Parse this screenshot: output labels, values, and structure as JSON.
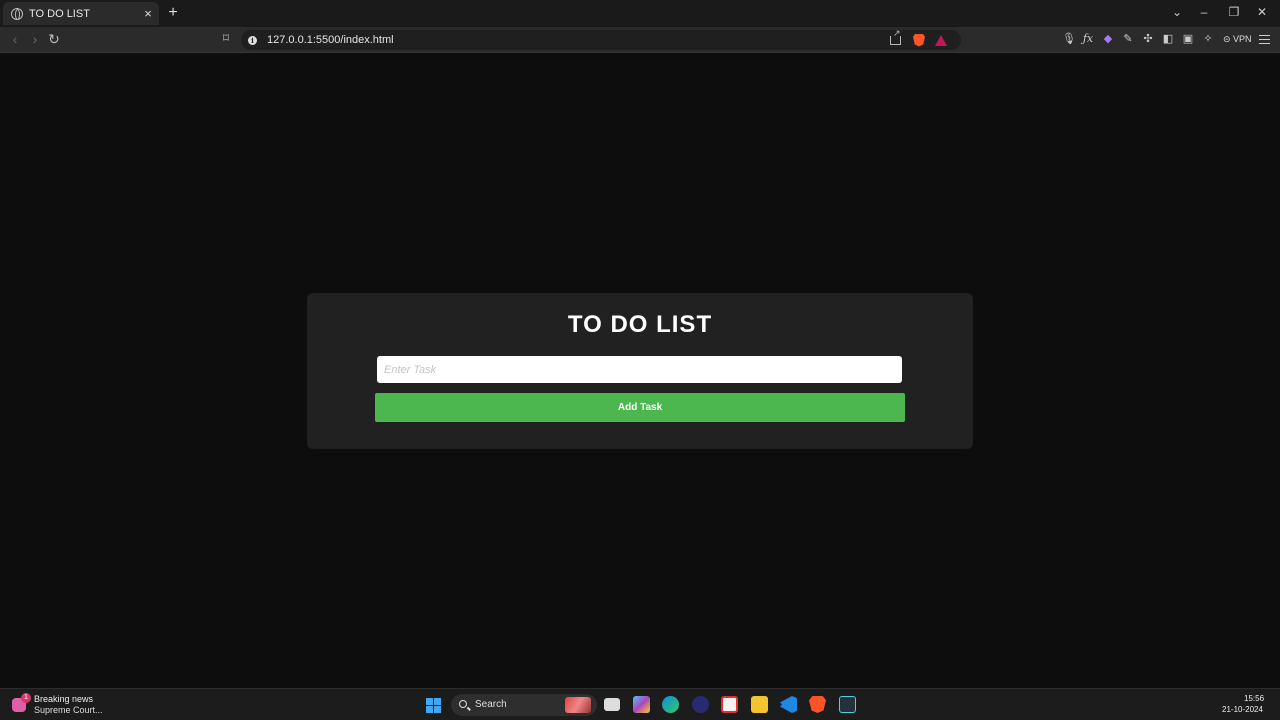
{
  "browser": {
    "tab_title": "TO DO LIST",
    "tab_close": "×",
    "new_tab": "+",
    "url": "127.0.0.1:5500/index.html",
    "vpn_label": "VPN",
    "accent_brave": "#fb542b"
  },
  "app": {
    "title": "TO DO LIST",
    "input_placeholder": "Enter Task",
    "input_value": "",
    "add_button_label": "Add Task",
    "button_color": "#4db74f",
    "card_color": "#212121",
    "background_color": "#0d0d0d"
  },
  "taskbar": {
    "news_badge": "1",
    "news_title": "Breaking news",
    "news_subtitle": "Supreme Court...",
    "search_label": "Search",
    "time": "15:56",
    "date": "21-10-2024"
  }
}
